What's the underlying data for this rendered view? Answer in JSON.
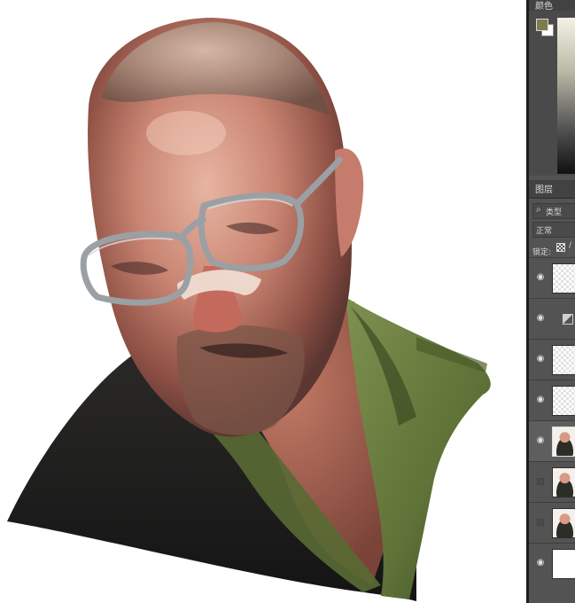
{
  "panels": {
    "color": {
      "tab_label": "颜色",
      "foreground_color": "#7d7e4d",
      "background_color": "#ffffff"
    },
    "layers": {
      "tab_label": "图层",
      "filter_label": "类型",
      "blend_mode": "正常",
      "lock_label": "锁定:",
      "icons": [
        "search-icon",
        "eye-icon",
        "checkerboard-lock-icon",
        "adjustment-icon"
      ],
      "layers": [
        {
          "visible": true,
          "thumb": "transparent",
          "selected": false
        },
        {
          "visible": true,
          "thumb": "adjustment",
          "selected": false
        },
        {
          "visible": true,
          "thumb": "transparent",
          "selected": false
        },
        {
          "visible": true,
          "thumb": "transparent",
          "selected": false
        },
        {
          "visible": true,
          "thumb": "portrait",
          "selected": true
        },
        {
          "visible": false,
          "thumb": "portrait",
          "selected": false
        },
        {
          "visible": false,
          "thumb": "portrait",
          "selected": false
        },
        {
          "visible": true,
          "thumb": "white",
          "selected": false
        }
      ]
    }
  },
  "canvas": {
    "subject": "digital painted portrait",
    "accent_colors": {
      "skin": "#c9836f",
      "jacket": "#6d8040",
      "shirt": "#1f1f1f",
      "glasses": "#8a8f92"
    }
  }
}
